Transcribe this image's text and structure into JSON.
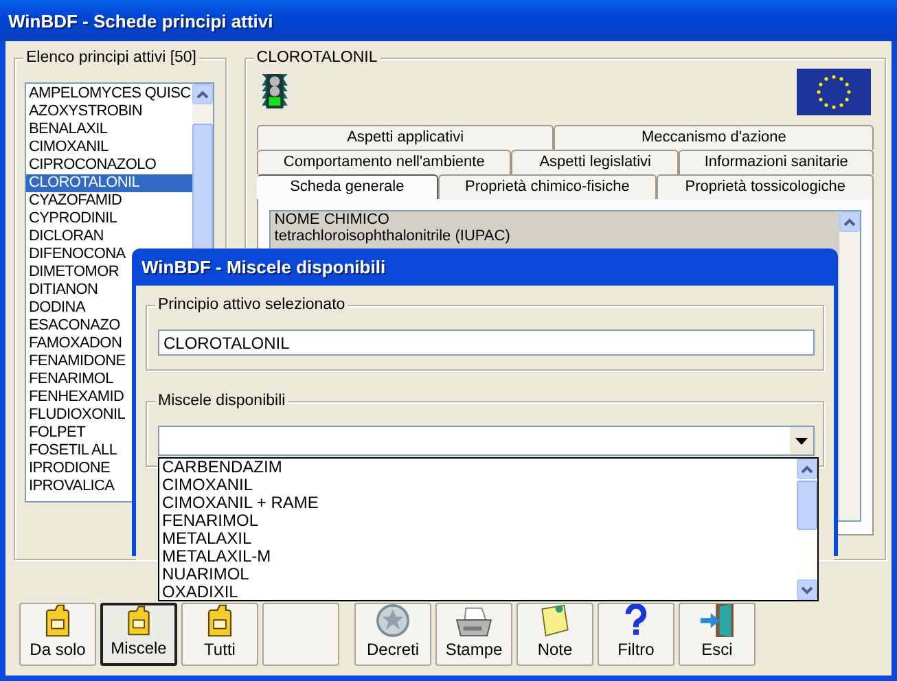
{
  "window": {
    "title": "WinBDF - Schede principi attivi"
  },
  "list_panel": {
    "title": "Elenco principi attivi [50]",
    "items": [
      {
        "label": "AMPELOMYCES QUISC",
        "selected": false
      },
      {
        "label": "AZOXYSTROBIN",
        "selected": false
      },
      {
        "label": "BENALAXIL",
        "selected": false
      },
      {
        "label": "CIMOXANIL",
        "selected": false
      },
      {
        "label": "CIPROCONAZOLO",
        "selected": false
      },
      {
        "label": "CLOROTALONIL",
        "selected": true
      },
      {
        "label": "CYAZOFAMID",
        "selected": false
      },
      {
        "label": "CYPRODINIL",
        "selected": false
      },
      {
        "label": "DICLORAN",
        "selected": false
      },
      {
        "label": "DIFENOCONA",
        "selected": false
      },
      {
        "label": "DIMETOMOR",
        "selected": false
      },
      {
        "label": "DITIANON",
        "selected": false
      },
      {
        "label": "DODINA",
        "selected": false
      },
      {
        "label": "ESACONAZO",
        "selected": false
      },
      {
        "label": "FAMOXADON",
        "selected": false
      },
      {
        "label": "FENAMIDONE",
        "selected": false
      },
      {
        "label": "FENARIMOL",
        "selected": false
      },
      {
        "label": "FENHEXAMID",
        "selected": false
      },
      {
        "label": "FLUDIOXONIL",
        "selected": false
      },
      {
        "label": "FOLPET",
        "selected": false
      },
      {
        "label": "FOSETIL ALL",
        "selected": false
      },
      {
        "label": "IPRODIONE",
        "selected": false
      },
      {
        "label": "IPROVALICA",
        "selected": false
      }
    ]
  },
  "detail_panel": {
    "title": "CLOROTALONIL",
    "tab_rows": [
      [
        {
          "label": "Aspetti applicativi",
          "selected": false
        },
        {
          "label": "Meccanismo d'azione",
          "selected": false
        }
      ],
      [
        {
          "label": "Comportamento nell'ambiente",
          "selected": false
        },
        {
          "label": "Aspetti legislativi",
          "selected": false
        },
        {
          "label": "Informazioni sanitarie",
          "selected": false
        }
      ],
      [
        {
          "label": "Scheda generale",
          "selected": true
        },
        {
          "label": "Proprietà chimico-fisiche",
          "selected": false
        },
        {
          "label": "Proprietà tossicologiche",
          "selected": false
        }
      ]
    ],
    "content": {
      "heading": "NOME CHIMICO",
      "text": "tetrachloroisophthalonitrile (IUPAC)"
    }
  },
  "toolbar": [
    {
      "label": "Da solo",
      "kind": "jerrycan",
      "pressed": false
    },
    {
      "label": "Miscele",
      "kind": "jerrycan",
      "pressed": true
    },
    {
      "label": "Tutti",
      "kind": "jerrycan",
      "pressed": false
    },
    {
      "kind": "blank",
      "pressed": false
    },
    {
      "label": "Decreti",
      "kind": "emblem",
      "pressed": false
    },
    {
      "label": "Stampe",
      "kind": "printer",
      "pressed": false
    },
    {
      "label": "Note",
      "kind": "note",
      "pressed": false
    },
    {
      "label": "Filtro",
      "kind": "help",
      "pressed": false
    },
    {
      "label": "Esci",
      "kind": "exit",
      "pressed": false
    }
  ],
  "dialog": {
    "title": "WinBDF - Miscele disponibili",
    "selected_group": {
      "title": "Principio attivo selezionato",
      "value": "CLOROTALONIL"
    },
    "mixtures_group": {
      "title": "Miscele disponibili"
    },
    "dropdown": {
      "items": [
        "CARBENDAZIM",
        "CIMOXANIL",
        "CIMOXANIL + RAME",
        "FENARIMOL",
        "METALAXIL",
        "METALAXIL-M",
        "NUARIMOL",
        "OXADIXIL"
      ]
    }
  }
}
